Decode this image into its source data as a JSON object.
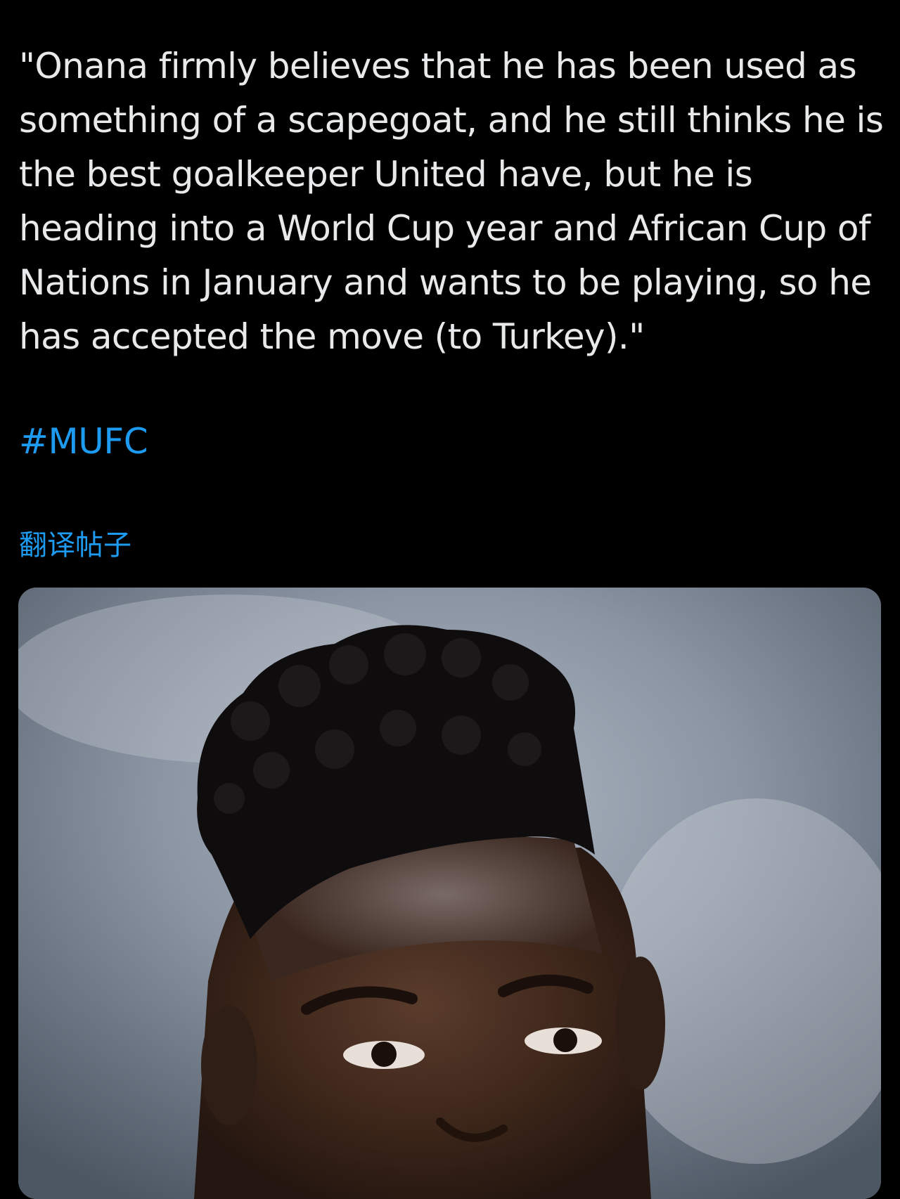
{
  "tweet": {
    "text": "\"Onana firmly believes that he has been used as something of a scapegoat, and he still thinks he is the best goalkeeper United have, but he is heading into a World Cup year and African Cup of Nations in January and wants to be playing, so he has accepted the move (to Turkey).\"",
    "hashtag": "#MUFC",
    "translate_label": "翻译帖子"
  },
  "colors": {
    "background": "#000000",
    "text": "#e7e9ea",
    "link": "#1d9bf0"
  }
}
